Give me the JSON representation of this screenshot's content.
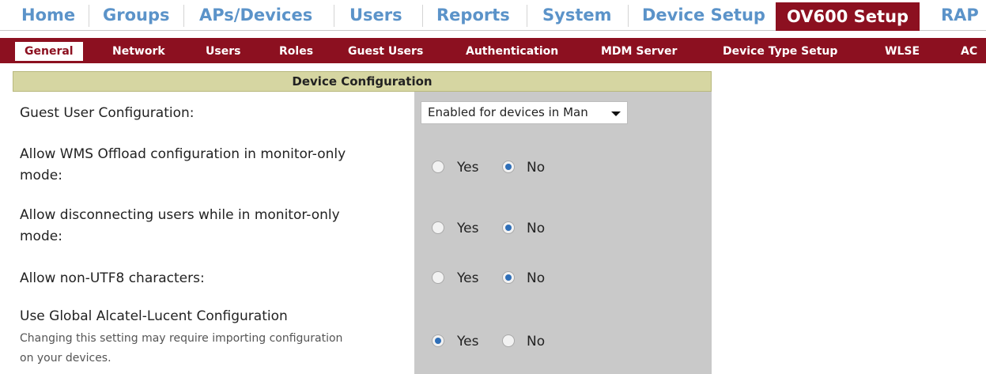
{
  "top_nav": {
    "tabs": [
      "Home",
      "Groups",
      "APs/Devices",
      "Users",
      "Reports",
      "System",
      "Device Setup",
      "OV600 Setup",
      "RAP"
    ],
    "active": "OV600 Setup"
  },
  "sub_nav": {
    "tabs": [
      "General",
      "Network",
      "Users",
      "Roles",
      "Guest Users",
      "Authentication",
      "MDM Server",
      "Device Type Setup",
      "WLSE",
      "AC"
    ],
    "active": "General"
  },
  "panel": {
    "title": "Device Configuration",
    "guest_user": {
      "label": "Guest User Configuration:",
      "value": "Enabled for devices in Man"
    },
    "wms_offload": {
      "label_line1": "Allow WMS Offload configuration in monitor-only",
      "label_line2": "mode:",
      "yes": "Yes",
      "no": "No",
      "selected": "No"
    },
    "disconnect_users": {
      "label_line1": "Allow disconnecting users while in monitor-only",
      "label_line2": "mode:",
      "yes": "Yes",
      "no": "No",
      "selected": "No"
    },
    "non_utf8": {
      "label": "Allow non-UTF8 characters:",
      "yes": "Yes",
      "no": "No",
      "selected": "No"
    },
    "global_config": {
      "label": "Use Global Alcatel-Lucent Configuration",
      "help_line1": "Changing this setting may require importing configuration",
      "help_line2": "on your devices.",
      "yes": "Yes",
      "no": "No",
      "selected": "Yes"
    }
  },
  "colors": {
    "nav_link": "#5b93c9",
    "brand_dark_red": "#8c1020",
    "panel_header": "#d6d6a2",
    "control_column": "#c9c9c9",
    "radio_selected": "#2f6fb8"
  }
}
